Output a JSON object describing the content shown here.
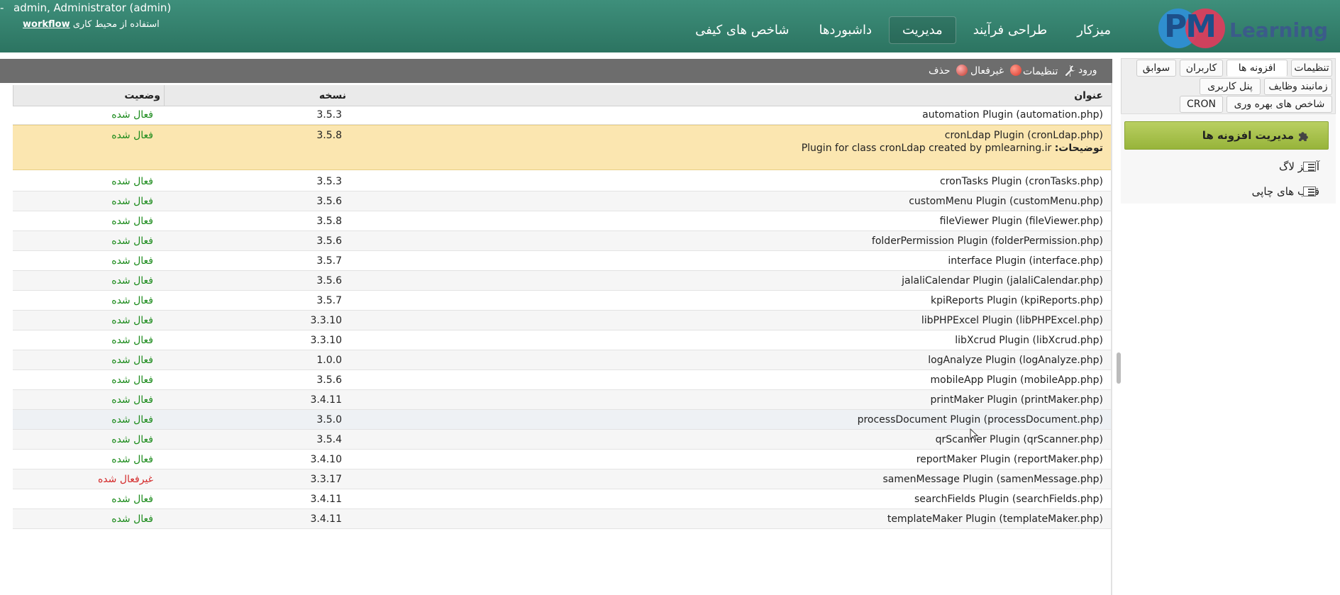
{
  "header": {
    "user": "admin, Administrator (admin)",
    "dash": "-",
    "workspace_prefix": "استفاده از محیط کاری",
    "workspace_name": "workflow",
    "nav": [
      {
        "label": "میزکار"
      },
      {
        "label": "طراحی فرآیند"
      },
      {
        "label": "مدیریت"
      },
      {
        "label": "داشبوردها"
      },
      {
        "label": "شاخص های کیفی"
      }
    ],
    "logo_pm": "PM",
    "logo_learning": "Learning"
  },
  "sidebar": {
    "tabs": [
      {
        "label": "تنظیمات"
      },
      {
        "label": "افزونه ها"
      },
      {
        "label": "کاربران"
      },
      {
        "label": "سوابق"
      },
      {
        "label": "زمانبند وظایف"
      },
      {
        "label": "پنل کاربری"
      },
      {
        "label": "شاخص های بهره وری"
      },
      {
        "label": "CRON"
      }
    ],
    "plugin_mgmt": "مدیریت افزونه ها",
    "links": [
      {
        "label": "آنالیز لاگ"
      },
      {
        "label": "قالب های چاپی"
      }
    ]
  },
  "toolbar": {
    "login": "ورود",
    "settings": "تنظیمات",
    "disable": "غیرفعال",
    "delete": "حذف"
  },
  "table": {
    "headers": {
      "title": "عنوان",
      "version": "نسخه",
      "status": "وضعیت"
    },
    "desc_label": "توضیحات:",
    "desc_text": "Plugin for class cronLdap created by pmlearning.ir",
    "rows": [
      {
        "title": "automation Plugin (automation.php)",
        "version": "3.5.3",
        "status": "فعال شده"
      },
      {
        "title": "cronLdap Plugin (cronLdap.php)",
        "version": "3.5.8",
        "status": "فعال شده"
      },
      {
        "title": "cronTasks Plugin (cronTasks.php)",
        "version": "3.5.3",
        "status": "فعال شده"
      },
      {
        "title": "customMenu Plugin (customMenu.php)",
        "version": "3.5.6",
        "status": "فعال شده"
      },
      {
        "title": "fileViewer Plugin (fileViewer.php)",
        "version": "3.5.8",
        "status": "فعال شده"
      },
      {
        "title": "folderPermission Plugin (folderPermission.php)",
        "version": "3.5.6",
        "status": "فعال شده"
      },
      {
        "title": "interface Plugin (interface.php)",
        "version": "3.5.7",
        "status": "فعال شده"
      },
      {
        "title": "jalaliCalendar Plugin (jalaliCalendar.php)",
        "version": "3.5.6",
        "status": "فعال شده"
      },
      {
        "title": "kpiReports Plugin (kpiReports.php)",
        "version": "3.5.7",
        "status": "فعال شده"
      },
      {
        "title": "libPHPExcel Plugin (libPHPExcel.php)",
        "version": "3.3.10",
        "status": "فعال شده"
      },
      {
        "title": "libXcrud Plugin (libXcrud.php)",
        "version": "3.3.10",
        "status": "فعال شده"
      },
      {
        "title": "logAnalyze Plugin (logAnalyze.php)",
        "version": "1.0.0",
        "status": "فعال شده"
      },
      {
        "title": "mobileApp Plugin (mobileApp.php)",
        "version": "3.5.6",
        "status": "فعال شده"
      },
      {
        "title": "printMaker Plugin (printMaker.php)",
        "version": "3.4.11",
        "status": "فعال شده"
      },
      {
        "title": "processDocument Plugin (processDocument.php)",
        "version": "3.5.0",
        "status": "فعال شده"
      },
      {
        "title": "qrScanner Plugin (qrScanner.php)",
        "version": "3.5.4",
        "status": "فعال شده"
      },
      {
        "title": "reportMaker Plugin (reportMaker.php)",
        "version": "3.4.10",
        "status": "فعال شده"
      },
      {
        "title": "samenMessage Plugin (samenMessage.php)",
        "version": "3.3.17",
        "status": "غیرفعال شده"
      },
      {
        "title": "searchFields Plugin (searchFields.php)",
        "version": "3.4.11",
        "status": "فعال شده"
      },
      {
        "title": "templateMaker Plugin (templateMaker.php)",
        "version": "3.4.11",
        "status": "فعال شده"
      }
    ]
  }
}
